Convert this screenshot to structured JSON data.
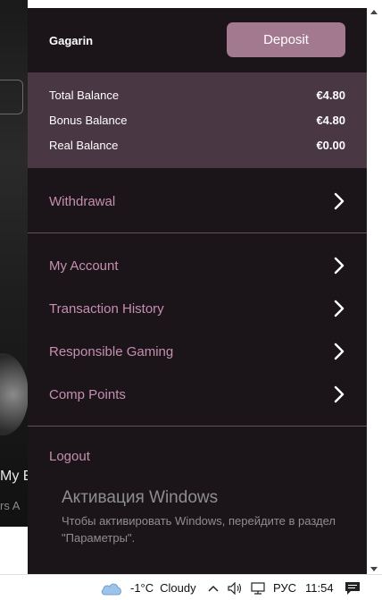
{
  "background": {
    "title_fragment": "My E",
    "subtitle_fragment": "rs A"
  },
  "drawer": {
    "username": "Gagarin",
    "deposit_label": "Deposit",
    "balances": [
      {
        "label": "Total Balance",
        "amount": "€4.80"
      },
      {
        "label": "Bonus Balance",
        "amount": "€4.80"
      },
      {
        "label": "Real Balance",
        "amount": "€0.00"
      }
    ],
    "withdrawal_label": "Withdrawal",
    "menu": [
      {
        "label": "My Account"
      },
      {
        "label": "Transaction History"
      },
      {
        "label": "Responsible Gaming"
      },
      {
        "label": "Comp Points"
      }
    ],
    "logout_label": "Logout"
  },
  "windows_activation": {
    "title": "Активация Windows",
    "text": "Чтобы активировать Windows, перейдите в раздел \"Параметры\"."
  },
  "taskbar": {
    "weather_icon": "cloud-icon",
    "temperature": "-1°C",
    "weather": "Cloudy",
    "language": "РУС",
    "time": "11:54",
    "icons": [
      "chevron-up-icon",
      "speaker-icon",
      "network-icon",
      "notification-icon"
    ]
  },
  "colors": {
    "drawer_bg": "#1b1519",
    "balance_bg": "#4a3744",
    "deposit_bg": "#a3798f",
    "menu_text": "#c58fb0"
  }
}
